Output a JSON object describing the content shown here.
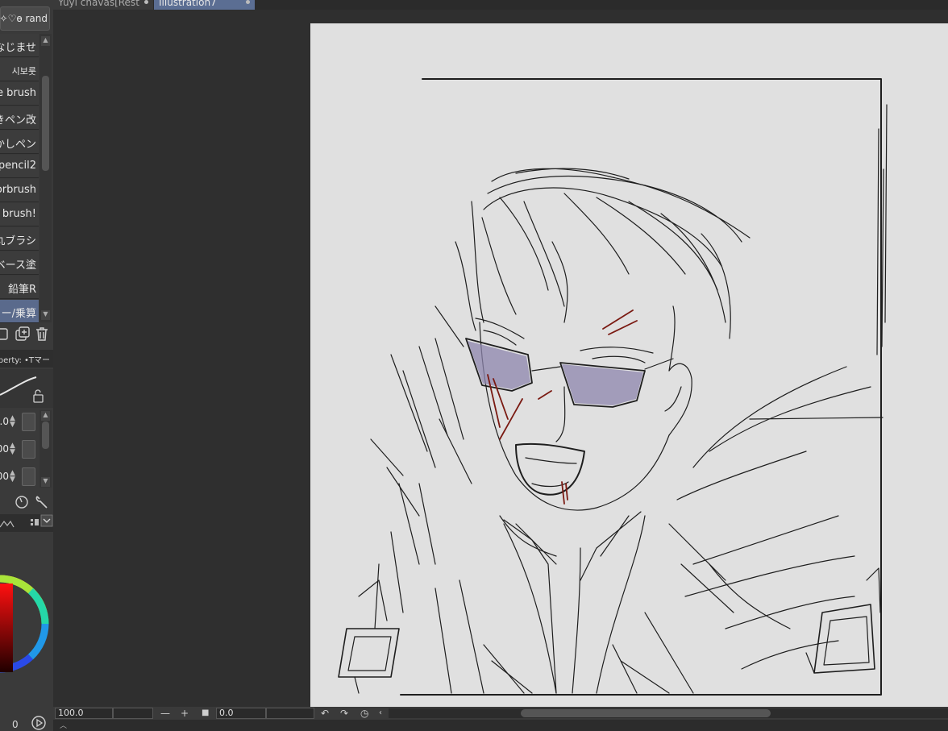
{
  "tabs": [
    {
      "label": "Yuyi chavas[Rest",
      "active": false
    },
    {
      "label": "Illustration7",
      "active": true
    }
  ],
  "brush_panel": {
    "header_label": "✧♡ɵ rand",
    "items": [
      {
        "label": "なじませ"
      },
      {
        "label": "시보룻"
      },
      {
        "label": "re brush"
      },
      {
        "label": "きペン改"
      },
      {
        "label": "かしペン"
      },
      {
        "label": "pencil2"
      },
      {
        "label": "orbrush"
      },
      {
        "label": "y brush!"
      },
      {
        "label": "丸ブラシ"
      },
      {
        "label": "ベース塗"
      },
      {
        "label": "鉛筆R"
      },
      {
        "label": "ー/乗算"
      }
    ]
  },
  "tool_property": {
    "header_label": "perty: •Tマー",
    "rows": [
      {
        "value": ".0"
      },
      {
        "value": "00"
      },
      {
        "value": "00"
      }
    ]
  },
  "color_panel": {
    "footer_value": "0"
  },
  "status_bar": {
    "zoom": "100.0",
    "rotation": "0.0"
  },
  "colors": {
    "panel_bg": "#3a3a3a",
    "workspace_bg": "#2f2f2f",
    "paper": "#e0e0e0",
    "selected_item": "#5a6a8c",
    "ink": "#1e1e1e",
    "glasses_tint": "#8e86ad",
    "blood": "#7a1a12"
  },
  "icons": [
    "duplicate-icon",
    "add-icon",
    "trash-icon",
    "lock-icon",
    "dial-icon",
    "wrench-icon",
    "play-icon",
    "undo-icon",
    "redo-icon",
    "reset-icon",
    "chevron-left-icon"
  ]
}
